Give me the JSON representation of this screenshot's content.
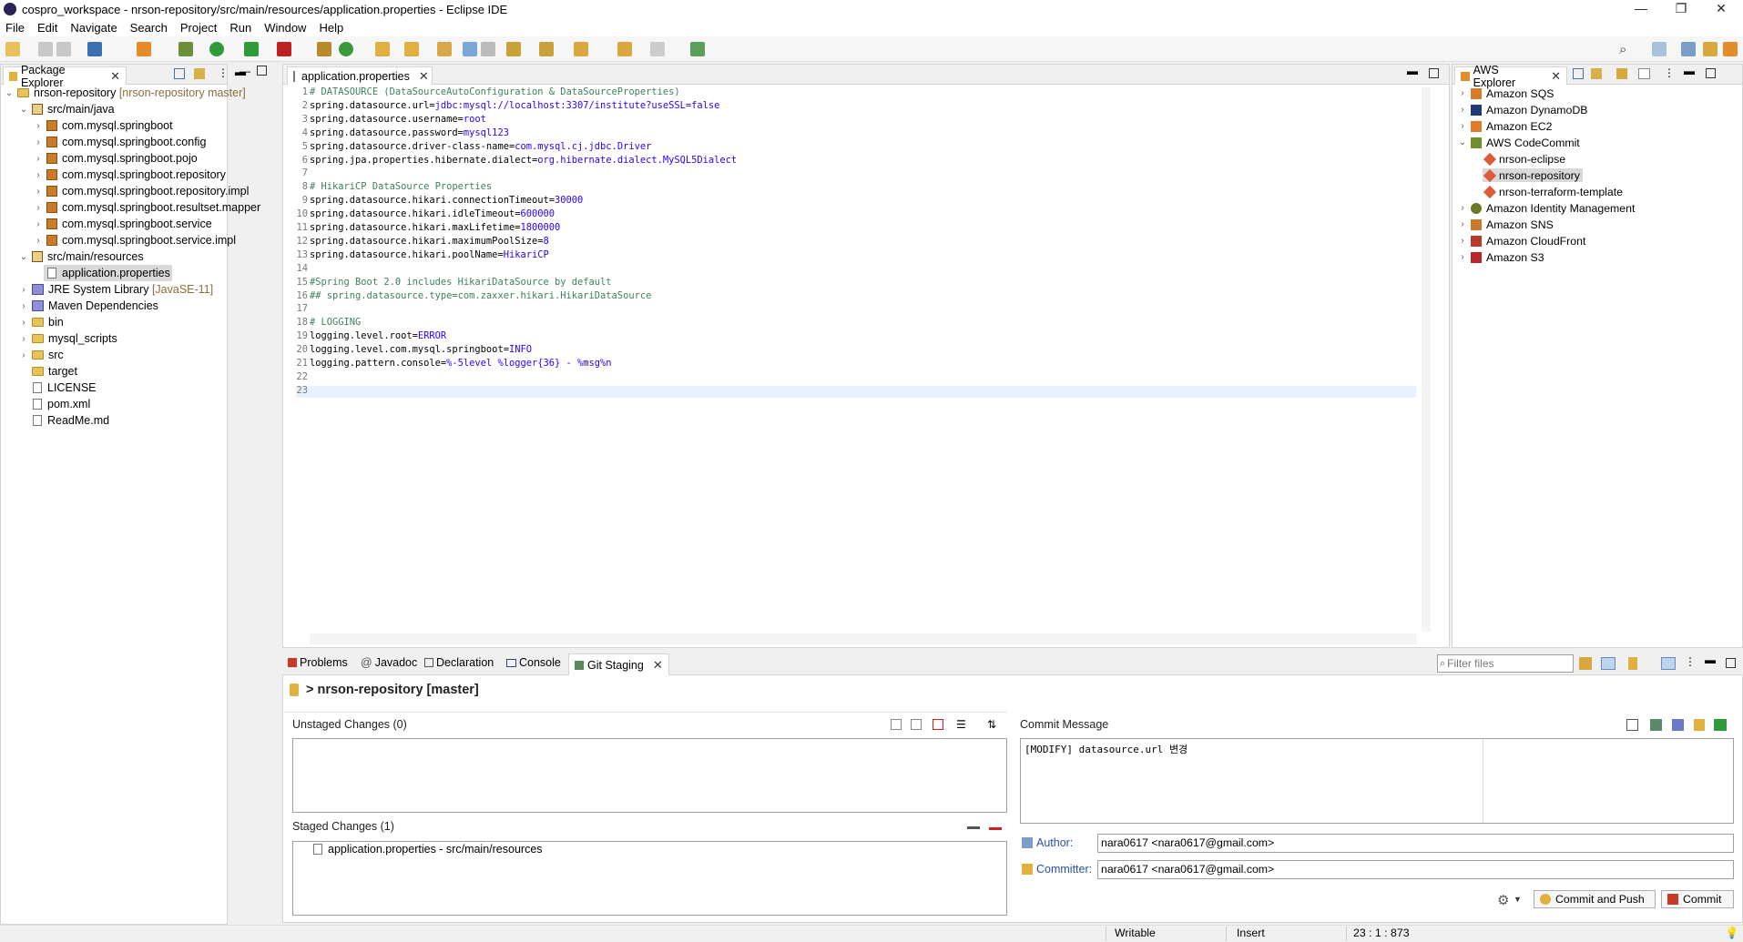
{
  "window": {
    "title": "cospro_workspace - nrson-repository/src/main/resources/application.properties - Eclipse IDE"
  },
  "menu": [
    "File",
    "Edit",
    "Navigate",
    "Search",
    "Project",
    "Run",
    "Window",
    "Help"
  ],
  "package_explorer": {
    "title": "Package Explorer",
    "project": "nrson-repository",
    "project_deco": "[nrson-repository master]",
    "src_java": "src/main/java",
    "packages": [
      "com.mysql.springboot",
      "com.mysql.springboot.config",
      "com.mysql.springboot.pojo",
      "com.mysql.springboot.repository",
      "com.mysql.springboot.repository.impl",
      "com.mysql.springboot.resultset.mapper",
      "com.mysql.springboot.service",
      "com.mysql.springboot.service.impl"
    ],
    "src_res": "src/main/resources",
    "selected_file": "application.properties",
    "jre": "JRE System Library",
    "jre_deco": "[JavaSE-11]",
    "others": [
      "Maven Dependencies",
      "bin",
      "mysql_scripts",
      "src",
      "target",
      "LICENSE",
      "pom.xml",
      "ReadMe.md"
    ]
  },
  "editor": {
    "tab": "application.properties",
    "lines": [
      {
        "n": "1",
        "k": "# DATASOURCE (DataSourceAutoConfiguration & DataSourceProperties)",
        "v": "",
        "c": true
      },
      {
        "n": "2",
        "k": "spring.datasource.url=",
        "v": "jdbc:mysql://localhost:3307/institute?useSSL=false"
      },
      {
        "n": "3",
        "k": "spring.datasource.username=",
        "v": "root"
      },
      {
        "n": "4",
        "k": "spring.datasource.password=",
        "v": "mysql123"
      },
      {
        "n": "5",
        "k": "spring.datasource.driver-class-name=",
        "v": "com.mysql.cj.jdbc.Driver"
      },
      {
        "n": "6",
        "k": "spring.jpa.properties.hibernate.dialect=",
        "v": "org.hibernate.dialect.MySQL5Dialect"
      },
      {
        "n": "7",
        "k": "",
        "v": ""
      },
      {
        "n": "8",
        "k": "# HikariCP DataSource Properties",
        "v": "",
        "c": true
      },
      {
        "n": "9",
        "k": "spring.datasource.hikari.connectionTimeout=",
        "v": "30000"
      },
      {
        "n": "10",
        "k": "spring.datasource.hikari.idleTimeout=",
        "v": "600000"
      },
      {
        "n": "11",
        "k": "spring.datasource.hikari.maxLifetime=",
        "v": "1800000"
      },
      {
        "n": "12",
        "k": "spring.datasource.hikari.maximumPoolSize=",
        "v": "8"
      },
      {
        "n": "13",
        "k": "spring.datasource.hikari.poolName=",
        "v": "HikariCP"
      },
      {
        "n": "14",
        "k": "",
        "v": ""
      },
      {
        "n": "15",
        "k": "#Spring Boot 2.0 includes HikariDataSource by default",
        "v": "",
        "c": true
      },
      {
        "n": "16",
        "k": "## spring.datasource.type=com.zaxxer.hikari.HikariDataSource",
        "v": "",
        "c": true
      },
      {
        "n": "17",
        "k": "",
        "v": ""
      },
      {
        "n": "18",
        "k": "# LOGGING",
        "v": "",
        "c": true
      },
      {
        "n": "19",
        "k": "logging.level.root=",
        "v": "ERROR"
      },
      {
        "n": "20",
        "k": "logging.level.com.mysql.springboot=",
        "v": "INFO"
      },
      {
        "n": "21",
        "k": "logging.pattern.console=",
        "v": "%-5level %logger{36} - %msg%n"
      },
      {
        "n": "22",
        "k": "",
        "v": ""
      },
      {
        "n": "23",
        "k": "",
        "v": ""
      }
    ]
  },
  "aws": {
    "title": "AWS Explorer",
    "items": [
      "Amazon SQS",
      "Amazon DynamoDB",
      "Amazon EC2",
      "AWS CodeCommit",
      "Amazon Identity Management",
      "Amazon SNS",
      "Amazon CloudFront",
      "Amazon S3"
    ],
    "repos": [
      "nrson-eclipse",
      "nrson-repository",
      "nrson-terraform-template"
    ]
  },
  "bottom": {
    "tabs": [
      "Problems",
      "Javadoc",
      "Declaration",
      "Console",
      "Git Staging"
    ],
    "filter_placeholder": "Filter files",
    "repo": "> nrson-repository [master]",
    "unstaged": "Unstaged Changes (0)",
    "staged": "Staged Changes (1)",
    "staged_item": "application.properties - src/main/resources",
    "commit_msg_label": "Commit Message",
    "commit_msg": "[MODIFY] datasource.url 변경",
    "author_label": "Author:",
    "author": "nara0617 <nara0617@gmail.com>",
    "committer_label": "Committer:",
    "committer": "nara0617 <nara0617@gmail.com>",
    "commit_push": "Commit and Push",
    "commit": "Commit"
  },
  "status": {
    "mode": "Writable",
    "insert": "Insert",
    "pos": "23 : 1 : 873"
  }
}
